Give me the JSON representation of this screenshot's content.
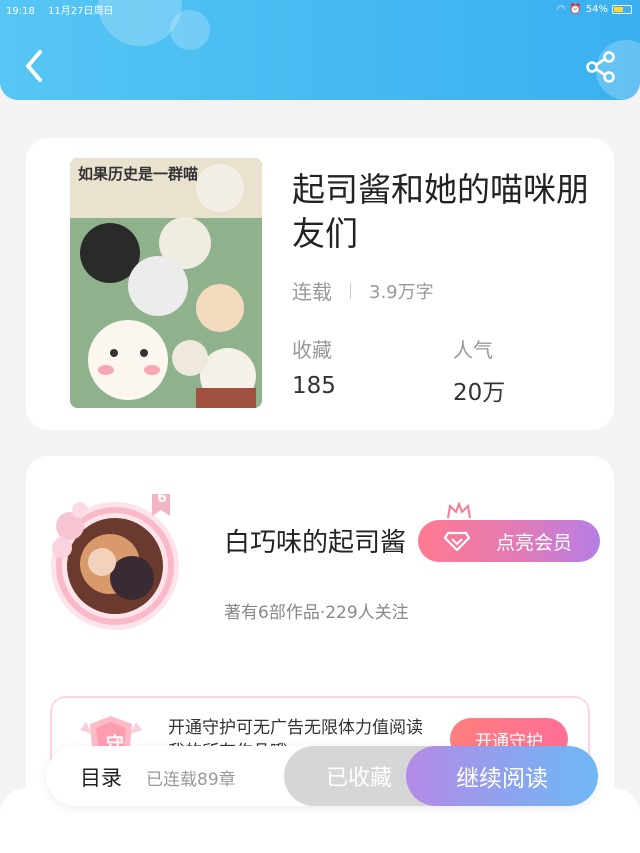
{
  "status_bar": {
    "time": "19:18",
    "date": "11月27日周日",
    "battery": "54%"
  },
  "header": {
    "back_icon": "chevron-left-icon",
    "share_icon": "share-icon"
  },
  "book": {
    "title": "起司酱和她的喵咪朋友们",
    "status": "连载",
    "word_count": "3.9万字",
    "favorites_label": "收藏",
    "favorites_value": "185",
    "popularity_label": "人气",
    "popularity_value": "20万",
    "cover_text": "如果历史是一群喵"
  },
  "author": {
    "name": "白巧味的起司酱",
    "level": "6",
    "vip_button": "点亮会员",
    "meta": "著有6部作品·229人关注"
  },
  "guard": {
    "icon_char": "守",
    "text": "开通守护可无广告无限体力值阅读我的所有作品哦",
    "button": "开通守护"
  },
  "bottom_bar": {
    "toc_label": "目录",
    "chapter_count": "已连载89章",
    "favorited_label": "已收藏",
    "continue_label": "继续阅读"
  },
  "colors": {
    "header": "#45b8f2",
    "vip_gradient_start": "#ff7a8f",
    "vip_gradient_end": "#b57fe6",
    "read_gradient_start": "#b48ae6",
    "read_gradient_end": "#6fb8f4"
  }
}
